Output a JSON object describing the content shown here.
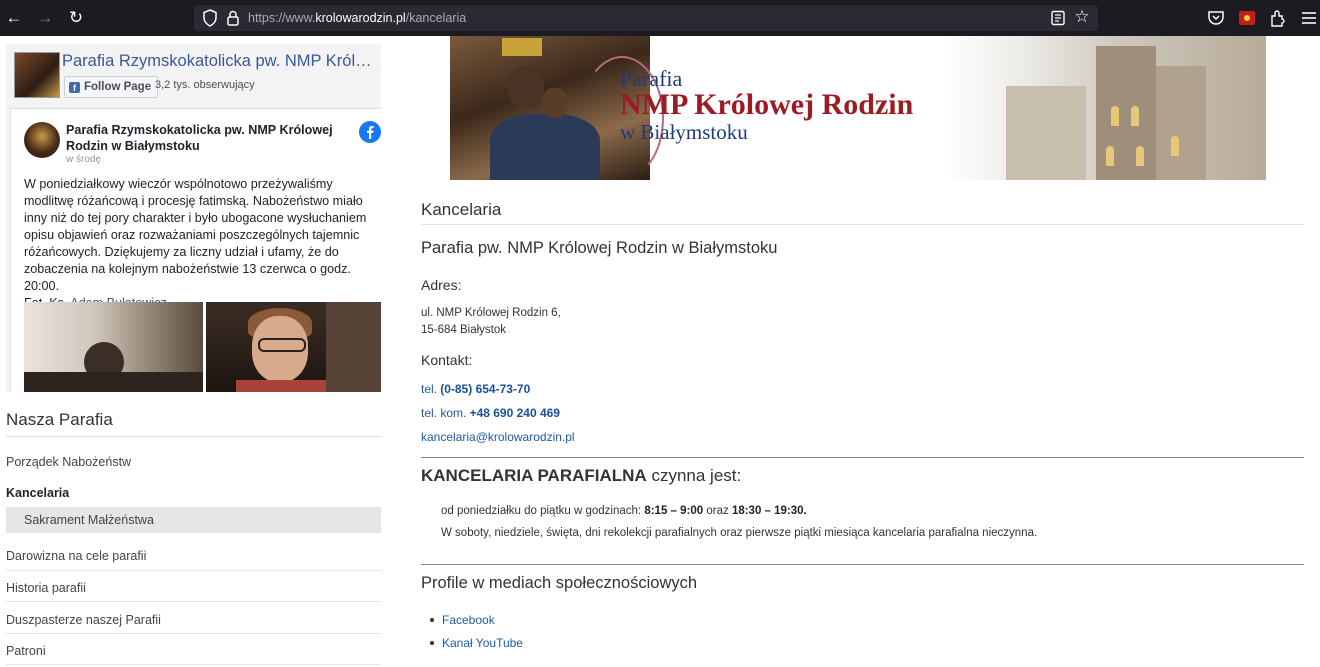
{
  "browser": {
    "url_prefix": "https://www.",
    "url_domain": "krolowarodzin.pl",
    "url_path": "/kancelaria"
  },
  "facebook": {
    "page_title": "Parafia Rzymskokatolicka pw. NMP Królowej Rodzin w Białymstoku",
    "follow_label": "Follow Page",
    "followers": "3,2 tys. obserwujący",
    "post_author": "Parafia Rzymskokatolicka pw. NMP Królowej Rodzin w Białymstoku",
    "post_time": "w środę",
    "post_text": "W poniedziałkowy wieczór wspólnotowo przeżywaliśmy modlitwę różańcową i procesję fatimską. Nabożeństwo miało inny niż do tej pory charakter i było ubogacone wysłuchaniem opisu objawień oraz rozważaniami poszczególnych tajemnic różańcowych. Dziękujemy za liczny udział i ufamy, że do zobaczenia na kolejnym nabożeństwie 13 czerwca o godz. 20:00.",
    "photo_credit_prefix": "Fot. Ks.",
    "photo_credit_name": "Adam Bułatewicz"
  },
  "sidebar": {
    "title": "Nasza Parafia",
    "items": [
      {
        "label": "Porządek Nabożeństw"
      },
      {
        "label": "Kancelaria"
      },
      {
        "label": "Sakrament Małżeństwa"
      },
      {
        "label": "Darowizna na cele parafii"
      },
      {
        "label": "Historia parafii"
      },
      {
        "label": "Duszpasterze naszej Parafii"
      },
      {
        "label": "Patroni"
      }
    ]
  },
  "banner": {
    "line1": "Parafia",
    "line2": "NMP Królowej Rodzin",
    "line3": "w Białymstoku"
  },
  "main": {
    "title": "Kancelaria",
    "subtitle": "Parafia pw. NMP Królowej Rodzin w Białymstoku",
    "address_heading": "Adres:",
    "address_line1": "ul. NMP Królowej Rodzin 6,",
    "address_line2": "15-684 Białystok",
    "contact_heading": "Kontakt:",
    "tel_label": "tel.",
    "tel_value": "(0-85) 654-73-70",
    "mobile_label": "tel. kom.",
    "mobile_value": "+48 690 240 469",
    "email": "kancelaria@krolowarodzin.pl",
    "hours_heading_bold": "KANCELARIA PARAFIALNA",
    "hours_heading_rest": "czynna jest:",
    "hours_line1_prefix": "od poniedziałku do piątku w godzinach:",
    "hours_range1": "8:15 – 9:00",
    "hours_mid": "oraz",
    "hours_range2": "18:30 – 19:30.",
    "hours_line2": "W soboty, niedziele, święta, dni rekolekcji parafialnych oraz pierwsze piątki miesiąca kancelaria parafialna nieczynna.",
    "social_heading": "Profile w mediach społecznościowych",
    "social_links": [
      "Facebook",
      "Kanał YouTube"
    ]
  }
}
